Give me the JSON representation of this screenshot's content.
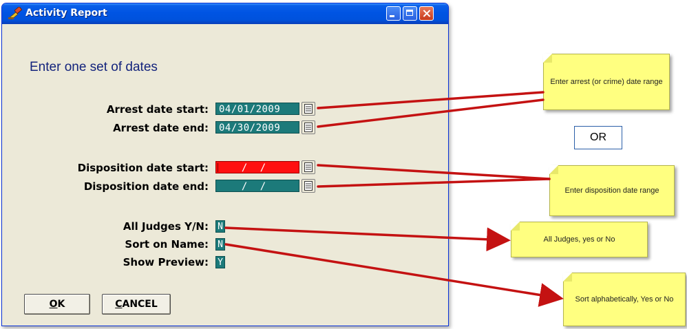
{
  "window": {
    "title": "Activity Report"
  },
  "form": {
    "heading": "Enter one set of dates",
    "arrest_start": {
      "label": "Arrest date start:",
      "value": "04/01/2009"
    },
    "arrest_end": {
      "label": "Arrest date end:",
      "value": "04/30/2009"
    },
    "disp_start": {
      "label": "Disposition date start:",
      "value": " /  /"
    },
    "disp_end": {
      "label": "Disposition date end:",
      "value": " /  /"
    },
    "all_judges": {
      "label": "All Judges Y/N:",
      "value": "N"
    },
    "sort_name": {
      "label": "Sort on Name:",
      "value": "N"
    },
    "show_preview": {
      "label": "Show Preview:",
      "value": "Y"
    }
  },
  "buttons": {
    "ok": {
      "accel": "O",
      "rest": "K"
    },
    "cancel": {
      "accel": "C",
      "rest": "ANCEL"
    }
  },
  "callouts": {
    "arrest": "Enter arrest (or crime) date range",
    "or": "OR",
    "disposition": "Enter disposition date range",
    "judges": "All Judges, yes or No",
    "sort": "Sort alphabetically, Yes or No"
  },
  "colors": {
    "field_teal": "#1c7a7a",
    "field_error": "#ff1010",
    "note_yellow": "#ffff80",
    "arrow_red": "#c41212"
  }
}
